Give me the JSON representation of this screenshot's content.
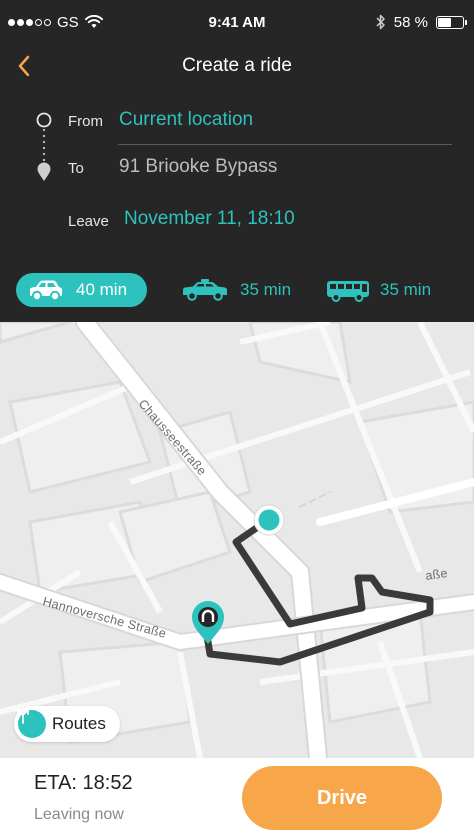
{
  "status_bar": {
    "carrier": "GS",
    "time": "9:41 AM",
    "battery_percent_label": "58 %",
    "battery_level": 0.58,
    "signal_bars": 3
  },
  "nav": {
    "title": "Create a ride"
  },
  "route": {
    "from_label": "From",
    "from_value": "Current location",
    "to_label": "To",
    "to_value": "91 Briooke Bypass",
    "leave_label": "Leave",
    "leave_value": "November 11, 18:10"
  },
  "transport_modes": [
    {
      "icon": "car-icon",
      "label": "40 min",
      "selected": true
    },
    {
      "icon": "taxi-icon",
      "label": "35 min",
      "selected": false
    },
    {
      "icon": "bus-icon",
      "label": "35 min",
      "selected": false
    }
  ],
  "map": {
    "street_1": "Chausseestraße",
    "street_2": "Hannoversche Straße",
    "street_3": "aße"
  },
  "routes_button": {
    "label": "Routes",
    "icon": "routes-icon"
  },
  "bottom": {
    "eta": "ETA: 18:52",
    "leaving": "Leaving now",
    "drive_label": "Drive"
  },
  "colors": {
    "accent": "#2dc2bd",
    "header_bg": "#262626",
    "drive_button": "#f7a64a",
    "back_arrow": "#f7a64a",
    "route_line": "#3a3a3a"
  }
}
